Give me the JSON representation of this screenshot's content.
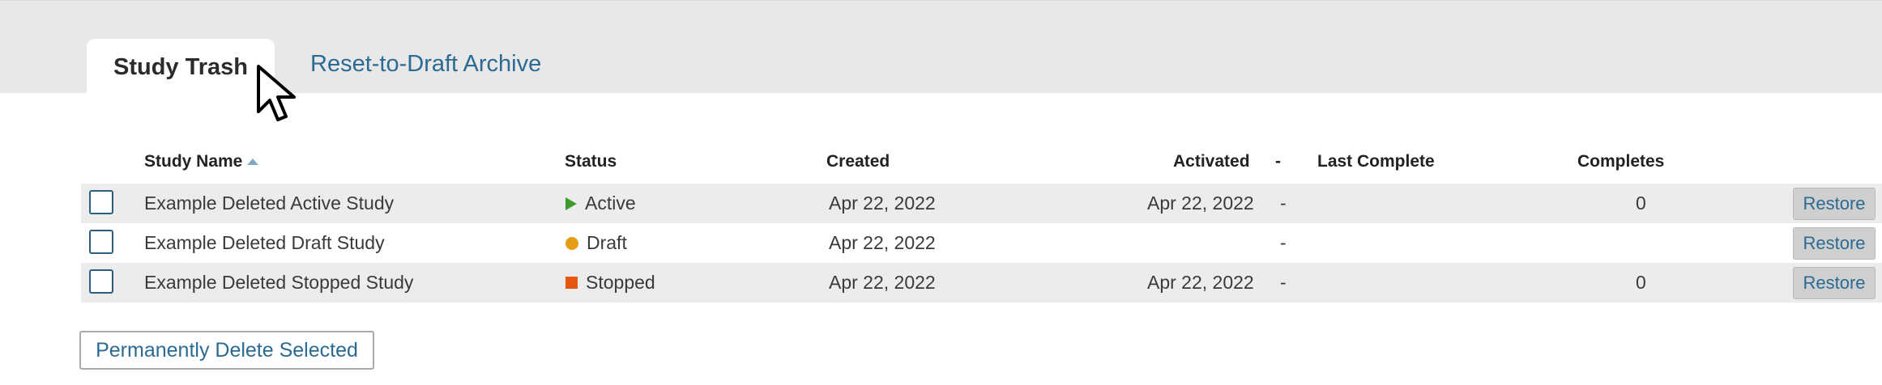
{
  "tabs": {
    "active": "Study Trash",
    "other": "Reset-to-Draft Archive"
  },
  "table": {
    "headers": {
      "study_name": "Study Name",
      "status": "Status",
      "created": "Created",
      "activated": "Activated",
      "dash": "-",
      "last_complete": "Last Complete",
      "completes": "Completes"
    },
    "rows": [
      {
        "name": "Example Deleted Active Study",
        "status": "Active",
        "status_icon": "play-triangle-icon",
        "created": "Apr 22, 2022",
        "activated": "Apr 22, 2022",
        "dash": "-",
        "last_complete": "",
        "completes": "0",
        "restore": "Restore"
      },
      {
        "name": "Example Deleted Draft Study",
        "status": "Draft",
        "status_icon": "circle-dot-icon",
        "created": "Apr 22, 2022",
        "activated": "",
        "dash": "-",
        "last_complete": "",
        "completes": "",
        "restore": "Restore"
      },
      {
        "name": "Example Deleted Stopped Study",
        "status": "Stopped",
        "status_icon": "stop-square-icon",
        "created": "Apr 22, 2022",
        "activated": "Apr 22, 2022",
        "dash": "-",
        "last_complete": "",
        "completes": "0",
        "restore": "Restore"
      }
    ]
  },
  "actions": {
    "delete_selected": "Permanently Delete Selected"
  },
  "colors": {
    "link": "#2a6a93",
    "active_status": "#3f9a2a",
    "draft_status": "#e49d15",
    "stopped_status": "#e4580f"
  }
}
